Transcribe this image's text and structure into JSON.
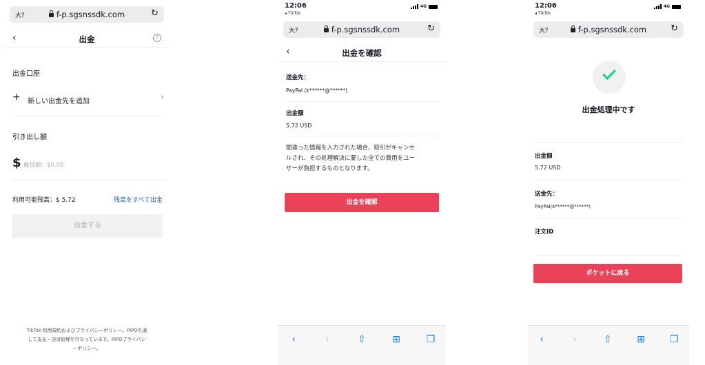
{
  "browser": {
    "text_size_label": "大ｱ",
    "url": "f-p.sgsnssdk.com",
    "time": "12:06",
    "back_app": "◂ TikTok",
    "network": "4G"
  },
  "screen1": {
    "title": "出金",
    "account_section": "出金口座",
    "add_method": "新しい出金先を追加",
    "amount_section": "引き出し額",
    "currency_symbol": "$",
    "amount_placeholder": "最低額：$0.00",
    "available_balance": "利用可能残高：$ 5.72",
    "withdraw_all": "残高をすべて出金",
    "withdraw_button": "出金する",
    "footer_line1": "TikTok 利用規約およびプライバシーポリシー。PIPOを通",
    "footer_line2": "して支払・決済処理を行なっています。PIPOプライバシ",
    "footer_line3": "ーポリシー。"
  },
  "screen2": {
    "title": "出金を確認",
    "recipient_label": "送金先：",
    "recipient_value": "PayPal (k******@******)",
    "amount_label": "出金額",
    "amount_value": "5.72 USD",
    "notice_line1": "間違った情報を入力された場合、取引がキャンセ",
    "notice_line2": "ルされ、その処理解決に要した全ての費用をユー",
    "notice_line3": "ザーが負担するものとなります。",
    "confirm_button": "出金を確認"
  },
  "screen3": {
    "status_title": "出金処理中です",
    "amount_label": "出金額",
    "amount_value": "5.72 USD",
    "recipient_label": "送金先：",
    "recipient_value": "PayPal(k******@******)",
    "order_id_label": "注文ID",
    "back_button": "ポケットに戻る"
  },
  "colors": {
    "accent_red": "#ea4359",
    "link_blue": "#2a5fa8",
    "check_green": "#20c997",
    "safari_blue": "#1a73e8"
  },
  "icons": [
    "back-chevron-icon",
    "help-icon",
    "plus-icon",
    "chevron-right-icon",
    "lock-icon",
    "reload-icon",
    "share-icon",
    "bookmarks-icon",
    "tabs-icon",
    "checkmark-icon"
  ]
}
